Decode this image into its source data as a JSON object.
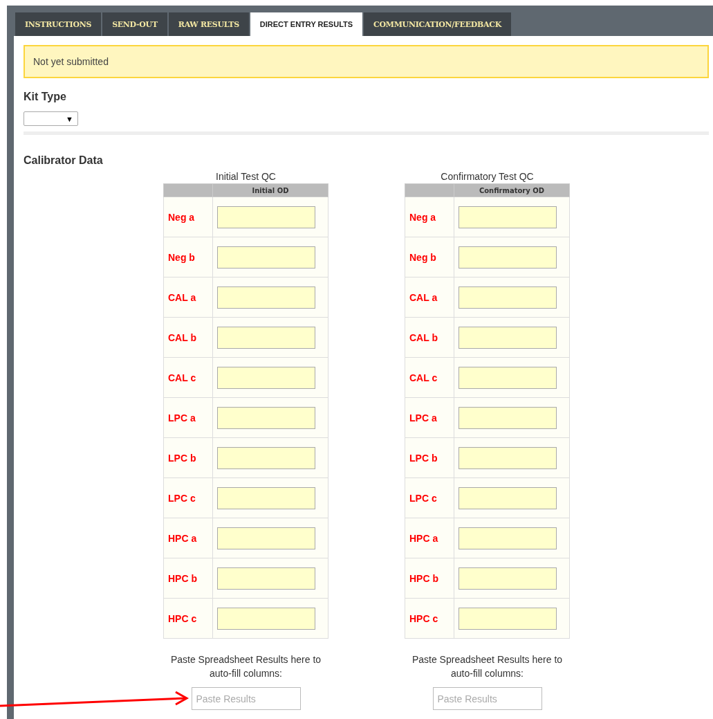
{
  "tabs": [
    {
      "label": "INSTRUCTIONS",
      "selected": false
    },
    {
      "label": "SEND-OUT",
      "selected": false
    },
    {
      "label": "RAW RESULTS",
      "selected": false
    },
    {
      "label": "DIRECT ENTRY RESULTS",
      "selected": true
    },
    {
      "label": "COMMUNICATION/FEEDBACK",
      "selected": false
    }
  ],
  "status_alert": "Not yet submitted",
  "kit_type": {
    "label": "Kit Type",
    "arrow": "▼"
  },
  "calibrator_data": {
    "title": "Calibrator Data",
    "tables": [
      {
        "title": "Initial Test QC",
        "column_header": "Initial OD",
        "rows": [
          "Neg a",
          "Neg b",
          "CAL a",
          "CAL b",
          "CAL c",
          "LPC a",
          "LPC b",
          "LPC c",
          "HPC a",
          "HPC b",
          "HPC c"
        ],
        "paste_hint": "Paste Spreadsheet Results here to auto-fill columns:",
        "paste_placeholder": "Paste Results"
      },
      {
        "title": "Confirmatory Test QC",
        "column_header": "Confirmatory OD",
        "rows": [
          "Neg a",
          "Neg b",
          "CAL a",
          "CAL b",
          "CAL c",
          "LPC a",
          "LPC b",
          "LPC c",
          "HPC a",
          "HPC b",
          "HPC c"
        ],
        "paste_hint": "Paste Spreadsheet Results here to auto-fill columns:",
        "paste_placeholder": "Paste Results"
      }
    ]
  }
}
